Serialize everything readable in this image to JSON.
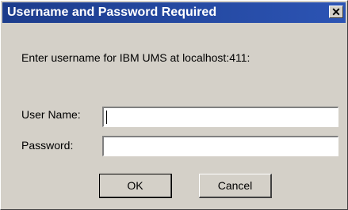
{
  "window": {
    "title": "Username and Password Required",
    "close_glyph": "✕"
  },
  "prompt": "Enter username for IBM UMS at localhost:411:",
  "fields": {
    "username_label": "User Name:",
    "username_value": "",
    "password_label": "Password:",
    "password_value": ""
  },
  "buttons": {
    "ok_label": "OK",
    "cancel_label": "Cancel"
  },
  "colors": {
    "titlebar_start": "#1c3c8c",
    "titlebar_end": "#2c54b4",
    "dialog_face": "#d4d0c8"
  },
  "icons": {
    "close": "close-icon"
  }
}
